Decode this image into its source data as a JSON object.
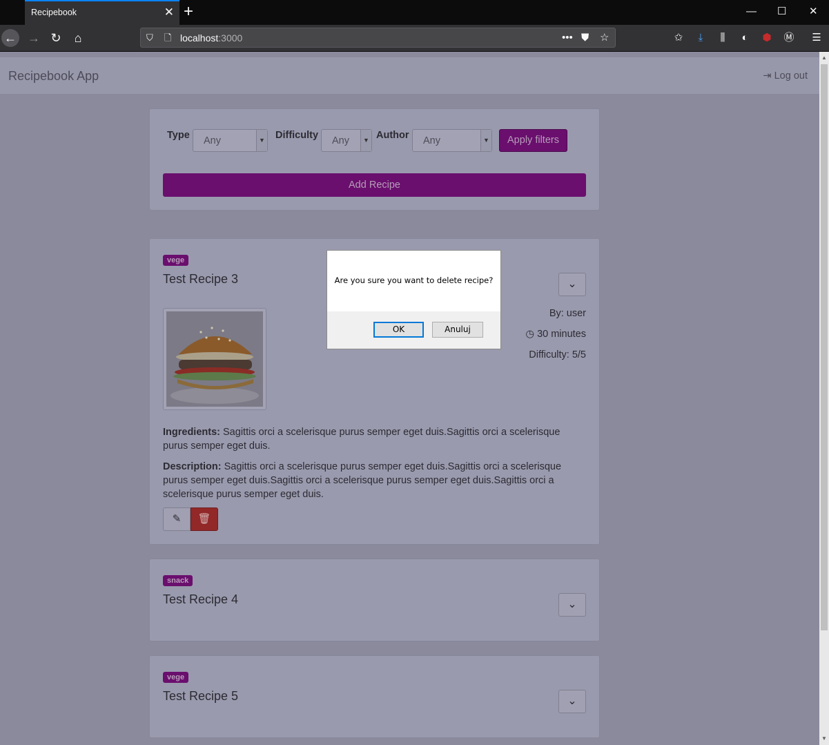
{
  "browser": {
    "tab_title": "Recipebook",
    "tab_close": "✕",
    "new_tab": "+",
    "url_host": "localhost",
    "url_port": ":3000",
    "window_controls": [
      "—",
      "☐",
      "✕"
    ]
  },
  "app": {
    "brand": "Recipebook App",
    "logout_label": "Log out"
  },
  "filters": {
    "type_label": "Type",
    "type_value": "Any",
    "difficulty_label": "Difficulty",
    "difficulty_value": "Any",
    "author_label": "Author",
    "author_value": "Any",
    "apply_label": "Apply filters",
    "add_recipe_label": "Add Recipe"
  },
  "recipes": [
    {
      "badge": "vege",
      "title": "Test Recipe 3",
      "author": "By: user",
      "time": "30 minutes",
      "difficulty": "Difficulty: 5/5",
      "ingredients_label": "Ingredients:",
      "ingredients": "Sagittis orci a scelerisque purus semper eget duis.Sagittis orci a scelerisque purus semper eget duis.",
      "description_label": "Description:",
      "description": "Sagittis orci a scelerisque purus semper eget duis.Sagittis orci a scelerisque purus semper eget duis.Sagittis orci a scelerisque purus semper eget duis.Sagittis orci a scelerisque purus semper eget duis."
    },
    {
      "badge": "snack",
      "title": "Test Recipe 4"
    },
    {
      "badge": "vege",
      "title": "Test Recipe 5"
    }
  ],
  "dialog": {
    "message": "Are you sure you want to delete recipe?",
    "ok_label": "OK",
    "cancel_label": "Anuluj"
  },
  "colors": {
    "accent": "#6a0f6e",
    "danger": "#922828",
    "focus": "#0078d7"
  }
}
